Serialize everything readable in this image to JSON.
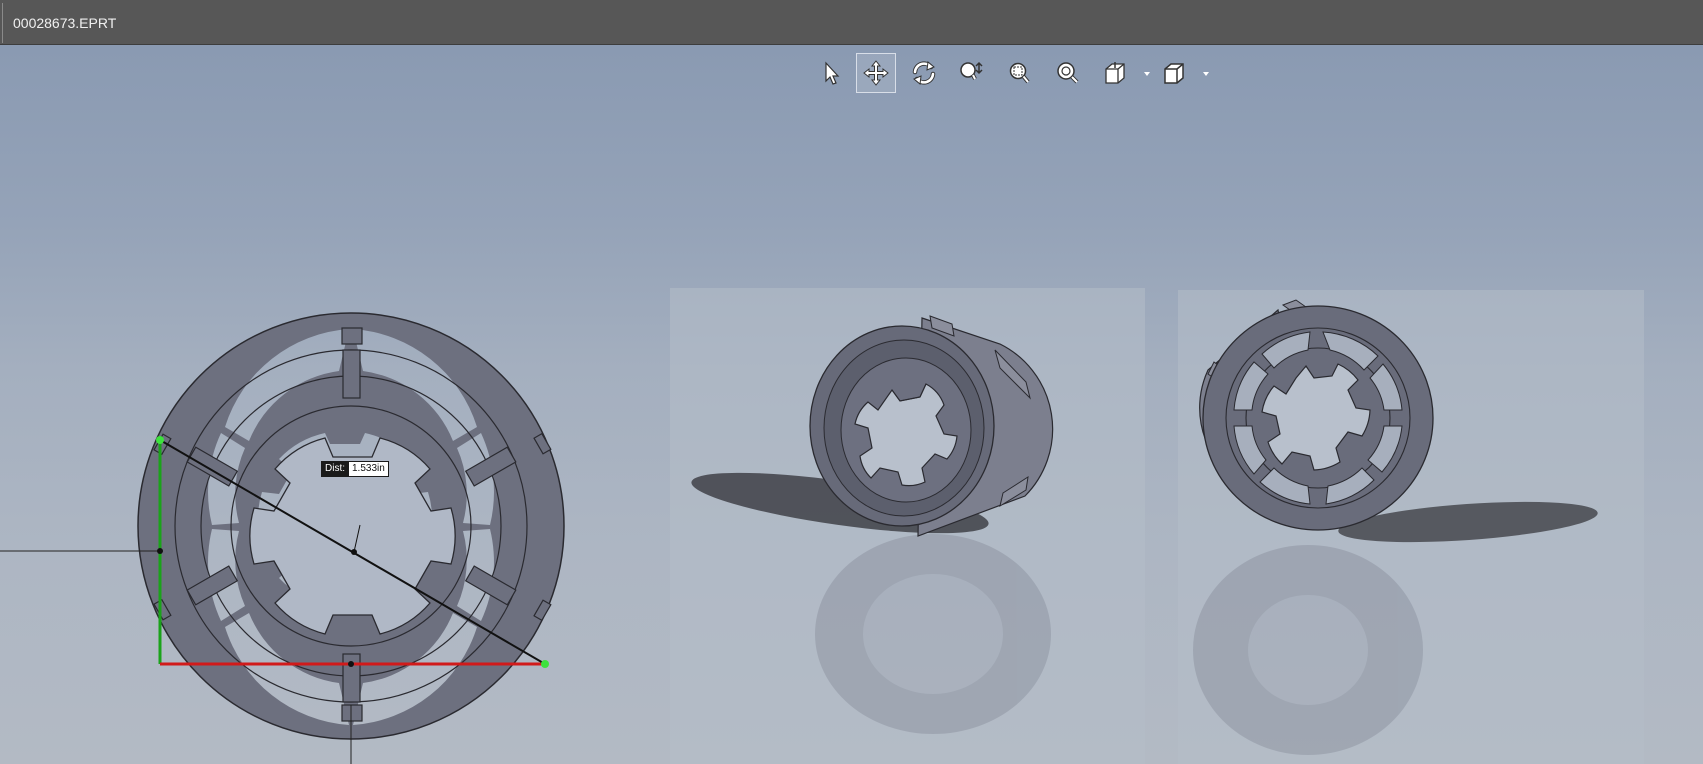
{
  "window": {
    "title": "00028673.EPRT"
  },
  "toolbar": {
    "buttons": [
      {
        "name": "select-tool-button",
        "icon": "cursor-arrow-icon",
        "active": false
      },
      {
        "name": "pan-tool-button",
        "icon": "move-arrows-icon",
        "active": true
      },
      {
        "name": "rotate-tool-button",
        "icon": "rotate-icon",
        "active": false
      },
      {
        "name": "zoom-in-out-button",
        "icon": "zoom-in-out-icon",
        "active": false
      },
      {
        "name": "zoom-to-area-button",
        "icon": "zoom-area-icon",
        "active": false
      },
      {
        "name": "zoom-to-fit-button",
        "icon": "zoom-fit-icon",
        "active": false
      },
      {
        "name": "view-orientation-button",
        "icon": "view-orientation-icon",
        "active": false,
        "dropdown": true
      },
      {
        "name": "display-style-button",
        "icon": "display-style-icon",
        "active": false,
        "dropdown": true
      }
    ]
  },
  "measurement": {
    "label": "Dist:",
    "value": "1.533in"
  },
  "colors": {
    "part_face": "#6d707f",
    "part_edge": "#2a2a30",
    "measure_line": "#111111",
    "vertical_edge_highlight": "#1aa31a",
    "horizontal_edge_highlight": "#d11a1a",
    "toolbar_icon": "#ffffff"
  }
}
